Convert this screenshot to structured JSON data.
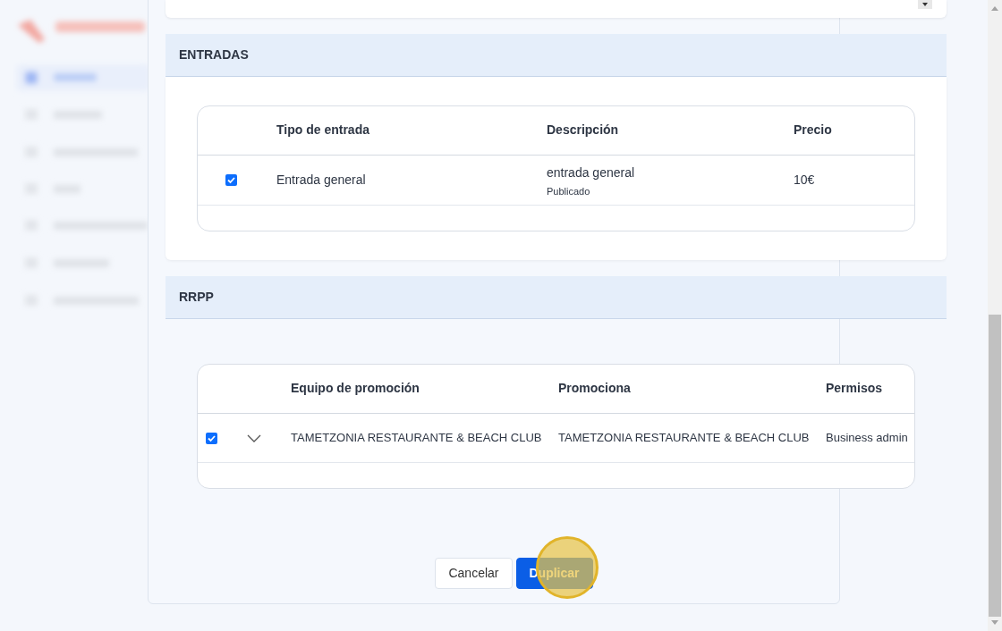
{
  "sections": [
    {
      "title": "ENTRADAS",
      "kind": "tickets",
      "columns": [
        "Tipo de entrada",
        "Descripción",
        "Precio"
      ],
      "rows": [
        {
          "checked": true,
          "type": "Entrada general",
          "description": "entrada general",
          "status": "Publicado",
          "price": "10€"
        }
      ]
    },
    {
      "title": "RRPP",
      "kind": "promoters",
      "columns": [
        "Equipo de promoción",
        "Promociona",
        "Permisos"
      ],
      "rows": [
        {
          "checked": true,
          "expanded": false,
          "team": "TAMETZONIA RESTAURANTE & BEACH CLUB",
          "promotes": "TAMETZONIA RESTAURANTE & BEACH CLUB",
          "permissions": "Business admin"
        }
      ]
    }
  ],
  "buttons": [
    {
      "label": "Cancelar",
      "kind": "secondary"
    },
    {
      "label": "Duplicar",
      "kind": "primary"
    }
  ]
}
